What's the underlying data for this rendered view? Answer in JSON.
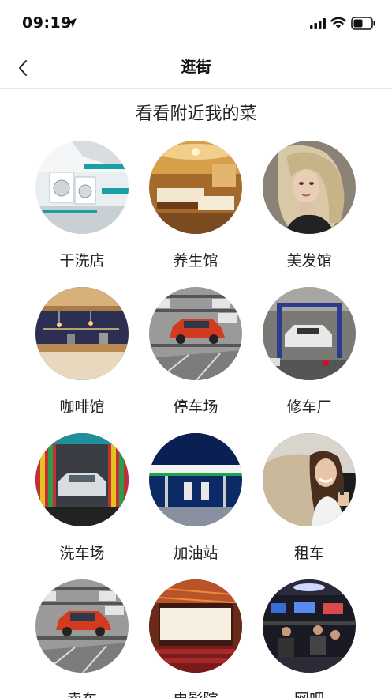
{
  "status": {
    "time": "09:19"
  },
  "nav": {
    "title": "逛街"
  },
  "section": {
    "title": "看看附近我的菜"
  },
  "items": [
    {
      "label": "干洗店",
      "icon": "laundry-icon"
    },
    {
      "label": "养生馆",
      "icon": "spa-room-icon"
    },
    {
      "label": "美发馆",
      "icon": "hair-model-icon"
    },
    {
      "label": "咖啡馆",
      "icon": "cafe-icon"
    },
    {
      "label": "停车场",
      "icon": "parking-icon"
    },
    {
      "label": "修车厂",
      "icon": "garage-icon"
    },
    {
      "label": "洗车场",
      "icon": "car-wash-icon"
    },
    {
      "label": "加油站",
      "icon": "gas-station-icon"
    },
    {
      "label": "租车",
      "icon": "car-rental-icon"
    },
    {
      "label": "卖车",
      "icon": "car-sale-icon"
    },
    {
      "label": "电影院",
      "icon": "cinema-icon"
    },
    {
      "label": "网吧",
      "icon": "internet-cafe-icon"
    }
  ]
}
